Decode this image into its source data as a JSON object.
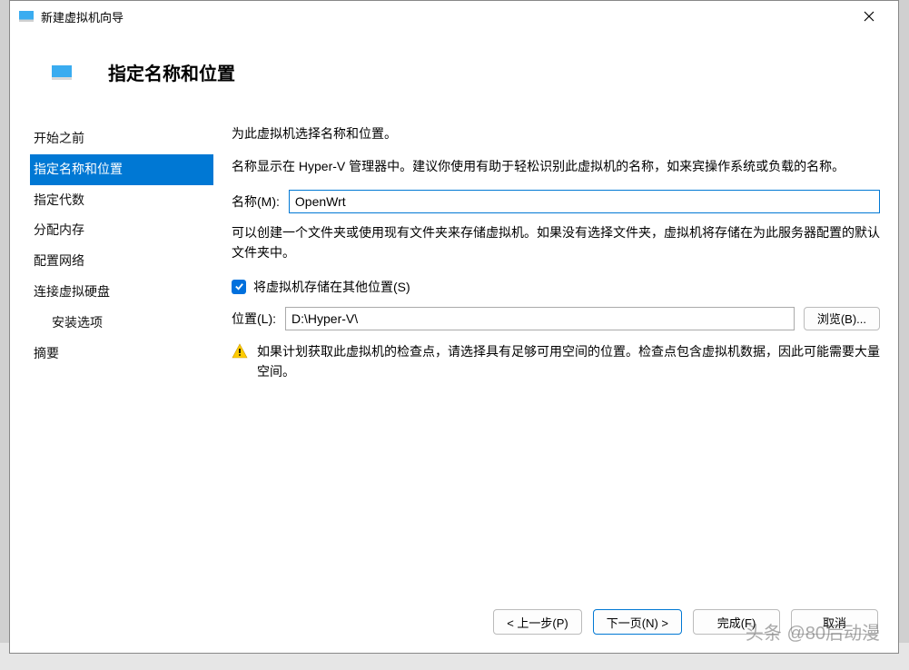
{
  "window": {
    "title": "新建虚拟机向导"
  },
  "header": {
    "title": "指定名称和位置"
  },
  "sidebar": {
    "items": [
      {
        "label": "开始之前",
        "selected": false
      },
      {
        "label": "指定名称和位置",
        "selected": true
      },
      {
        "label": "指定代数",
        "selected": false
      },
      {
        "label": "分配内存",
        "selected": false
      },
      {
        "label": "配置网络",
        "selected": false
      },
      {
        "label": "连接虚拟硬盘",
        "selected": false
      }
    ],
    "subitem": {
      "label": "安装选项"
    },
    "summary": {
      "label": "摘要"
    }
  },
  "main": {
    "desc1": "为此虚拟机选择名称和位置。",
    "desc2": "名称显示在 Hyper-V 管理器中。建议你使用有助于轻松识别此虚拟机的名称，如来宾操作系统或负载的名称。",
    "name_label": "名称(M):",
    "name_value": "OpenWrt",
    "desc3": "可以创建一个文件夹或使用现有文件夹来存储虚拟机。如果没有选择文件夹，虚拟机将存储在为此服务器配置的默认文件夹中。",
    "checkbox_label": "将虚拟机存储在其他位置(S)",
    "checkbox_checked": true,
    "location_label": "位置(L):",
    "location_value": "D:\\Hyper-V\\",
    "browse_label": "浏览(B)...",
    "warning_text": "如果计划获取此虚拟机的检查点，请选择具有足够可用空间的位置。检查点包含虚拟机数据，因此可能需要大量空间。"
  },
  "footer": {
    "prev": "< 上一步(P)",
    "next": "下一页(N) >",
    "finish": "完成(F)",
    "cancel": "取消"
  },
  "watermark": "头条 @80后动漫"
}
